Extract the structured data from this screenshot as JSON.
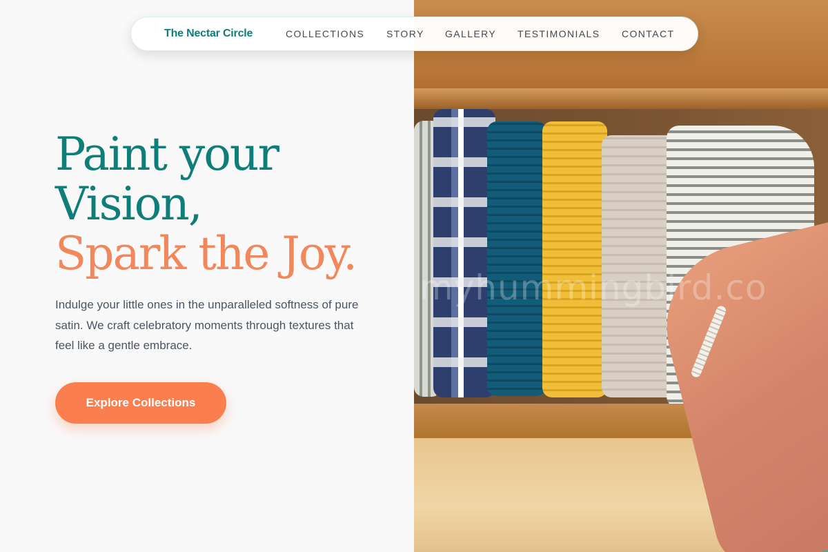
{
  "nav": {
    "brand": "The Nectar Circle",
    "links": [
      "COLLECTIONS",
      "STORY",
      "GALLERY",
      "TESTIMONIALS",
      "CONTACT"
    ]
  },
  "hero": {
    "headline_line1": "Paint your",
    "headline_line2": "Vision,",
    "headline_line3": "Spark the Joy.",
    "subtext": "Indulge your little ones in the unparalleled softness of pure satin. We craft celebratory moments through textures that feel like a gentle embrace.",
    "cta_label": "Explore Collections"
  },
  "photo": {
    "watermark": "myhummingbird.co",
    "description": "hand reaching into drawer of folded muslin blankets"
  },
  "colors": {
    "teal": "#0f7e78",
    "coral": "#f1875a",
    "cta": "#fb7e4e",
    "body_text": "#4a5560"
  }
}
